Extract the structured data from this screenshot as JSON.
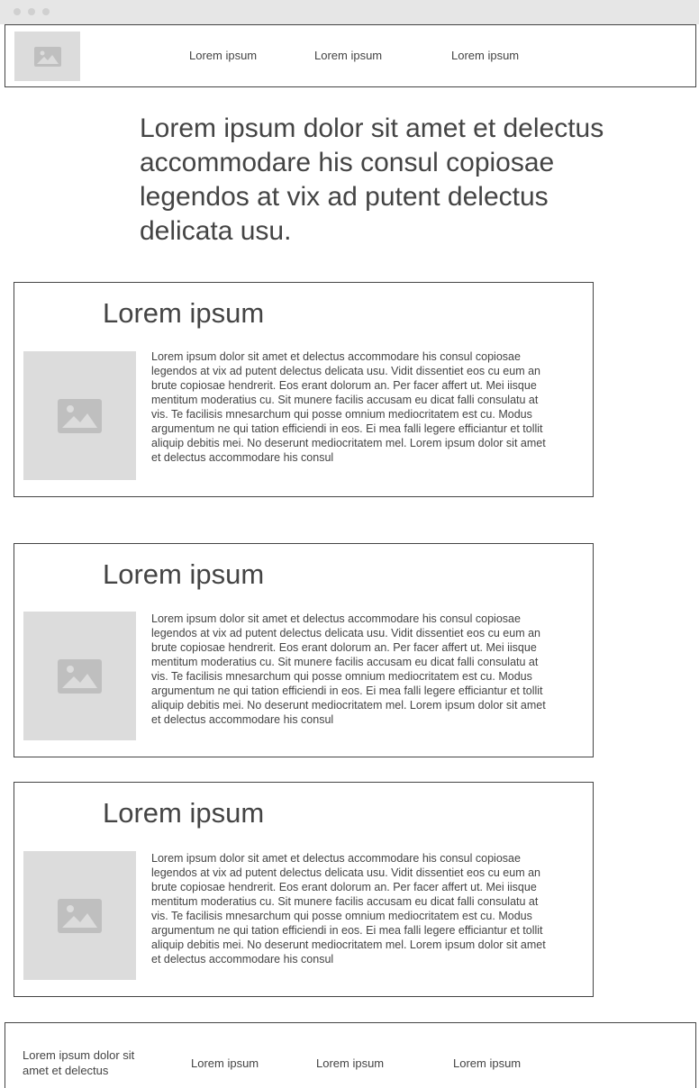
{
  "navbar": {
    "links": [
      "Lorem ipsum",
      "Lorem ipsum",
      "Lorem ipsum"
    ]
  },
  "hero": {
    "text": "Lorem ipsum dolor sit amet et delectus accommodare his consul copiosae legendos at vix ad putent delectus delicata usu."
  },
  "cards": [
    {
      "title": "Lorem ipsum",
      "body": "Lorem ipsum dolor sit amet et delectus accommodare his consul copiosae legendos at vix ad putent delectus delicata usu. Vidit dissentiet eos cu eum an brute copiosae hendrerit. Eos erant dolorum an. Per facer affert ut. Mei iisque mentitum moderatius cu. Sit munere facilis accusam eu dicat falli consulatu at vis. Te facilisis mnesarchum qui posse omnium mediocritatem est cu. Modus argumentum ne qui tation efficiendi in eos. Ei mea falli legere efficiantur et tollit aliquip debitis mei. No deserunt mediocritatem mel. Lorem ipsum dolor sit amet et delectus accommodare his consul"
    },
    {
      "title": "Lorem ipsum",
      "body": "Lorem ipsum dolor sit amet et delectus accommodare his consul copiosae legendos at vix ad putent delectus delicata usu. Vidit dissentiet eos cu eum an brute copiosae hendrerit. Eos erant dolorum an. Per facer affert ut. Mei iisque mentitum moderatius cu. Sit munere facilis accusam eu dicat falli consulatu at vis. Te facilisis mnesarchum qui posse omnium mediocritatem est cu. Modus argumentum ne qui tation efficiendi in eos. Ei mea falli legere efficiantur et tollit aliquip debitis mei. No deserunt mediocritatem mel. Lorem ipsum dolor sit amet et delectus accommodare his consul"
    },
    {
      "title": "Lorem ipsum",
      "body": "Lorem ipsum dolor sit amet et delectus accommodare his consul copiosae legendos at vix ad putent delectus delicata usu. Vidit dissentiet eos cu eum an brute copiosae hendrerit. Eos erant dolorum an. Per facer affert ut. Mei iisque mentitum moderatius cu. Sit munere facilis accusam eu dicat falli consulatu at vis. Te facilisis mnesarchum qui posse omnium mediocritatem est cu. Modus argumentum ne qui tation efficiendi in eos. Ei mea falli legere efficiantur et tollit aliquip debitis mei. No deserunt mediocritatem mel. Lorem ipsum dolor sit amet et delectus accommodare his consul"
    }
  ],
  "footer": {
    "text": "Lorem ipsum dolor sit amet et delectus",
    "links": [
      "Lorem ipsum",
      "Lorem ipsum",
      "Lorem ipsum"
    ]
  },
  "icons": {
    "logo": "image-placeholder-icon",
    "card_image": "image-placeholder-icon"
  },
  "colors": {
    "placeholder_bg": "#dcdcdc",
    "icon": "#bfbfbf",
    "text": "#444444",
    "border": "#444444",
    "titlebar": "#e6e6e6"
  }
}
